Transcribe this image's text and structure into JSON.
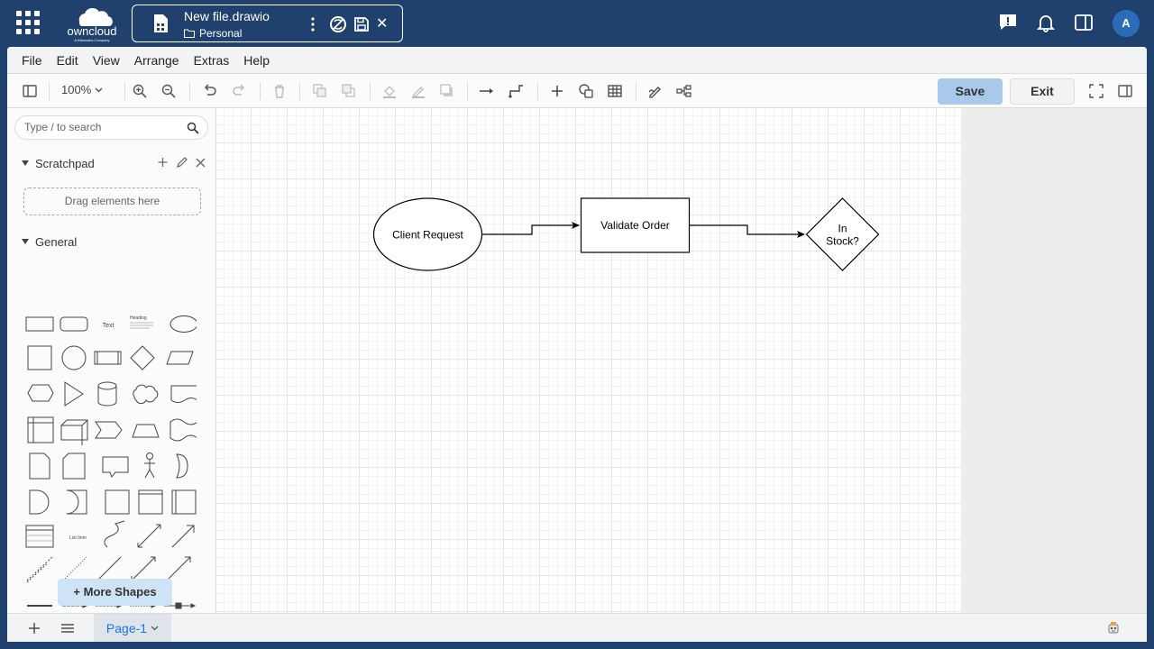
{
  "header": {
    "logo_text": "owncloud",
    "logo_tagline": "A Kiteworks Company",
    "file_name": "New file.drawio",
    "location": "Personal",
    "avatar_initial": "A"
  },
  "menu": [
    "File",
    "Edit",
    "View",
    "Arrange",
    "Extras",
    "Help"
  ],
  "toolbar": {
    "zoom": "100%",
    "save_label": "Save",
    "exit_label": "Exit"
  },
  "sidebar": {
    "search_placeholder": "Type / to search",
    "scratchpad_title": "Scratchpad",
    "dropzone_text": "Drag elements here",
    "general_title": "General",
    "shape_text_label": "Text",
    "shape_heading_label": "Heading",
    "shape_list_item_label": "List Item",
    "more_shapes_label": "More Shapes"
  },
  "diagram": {
    "nodes": [
      {
        "id": "client-request",
        "shape": "ellipse",
        "label": "Client Request"
      },
      {
        "id": "validate-order",
        "shape": "rectangle",
        "label": "Validate Order"
      },
      {
        "id": "in-stock",
        "shape": "diamond",
        "label_lines": [
          "In",
          "Stock?"
        ]
      }
    ]
  },
  "footer": {
    "page_tab": "Page-1"
  }
}
